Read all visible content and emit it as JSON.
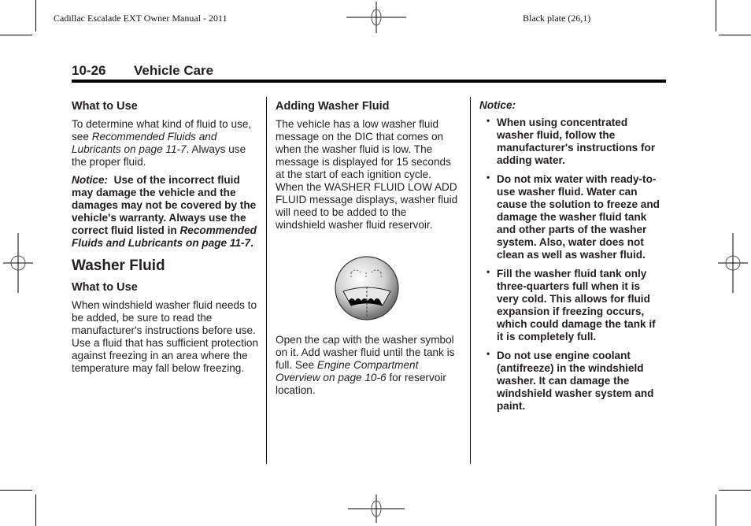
{
  "header": {
    "manual_title": "Cadillac Escalade EXT Owner Manual - 2011",
    "plate": "Black plate (26,1)"
  },
  "page": {
    "number": "10-26",
    "section": "Vehicle Care"
  },
  "col1": {
    "what_to_use_heading": "What to Use",
    "intro_text_1": "To determine what kind of fluid to use, see ",
    "intro_ref": "Recommended Fluids and Lubricants on page 11-7",
    "intro_text_2": ". Always use the proper fluid.",
    "notice_label": "Notice:",
    "notice_text": "Use of the incorrect fluid may damage the vehicle and the damages may not be covered by the vehicle's warranty. Always use the correct fluid listed in ",
    "notice_ref": "Recommended Fluids and Lubricants on page 11-7",
    "notice_end": ".",
    "washer_heading": "Washer Fluid",
    "washer_what_heading": "What to Use",
    "washer_text": "When windshield washer fluid needs to be added, be sure to read the manufacturer's instructions before use. Use a fluid that has sufficient protection against freezing in an area where the temperature may fall below freezing."
  },
  "col2": {
    "adding_heading": "Adding Washer Fluid",
    "adding_text": "The vehicle has a low washer fluid message on the DIC that comes on when the washer fluid is low. The message is displayed for 15 seconds at the start of each ignition cycle. When the WASHER FLUID LOW ADD FLUID message displays, washer fluid will need to be added to the windshield washer fluid reservoir.",
    "icon": "washer-fluid-cap-symbol",
    "cap_text_1": "Open the cap with the washer symbol on it. Add washer fluid until the tank is full. See ",
    "cap_ref": "Engine Compartment Overview on page 10-6",
    "cap_text_2": " for reservoir location."
  },
  "col3": {
    "notice_label": "Notice:",
    "bullet_glyph": "•",
    "bullets": [
      "When using concentrated washer fluid, follow the manufacturer's instructions for adding water.",
      "Do not mix water with ready-to-use washer fluid. Water can cause the solution to freeze and damage the washer fluid tank and other parts of the washer system. Also, water does not clean as well as washer fluid.",
      "Fill the washer fluid tank only three-quarters full when it is very cold. This allows for fluid expansion if freezing occurs, which could damage the tank if it is completely full.",
      "Do not use engine coolant (antifreeze) in the windshield washer. It can damage the windshield washer system and paint."
    ]
  }
}
